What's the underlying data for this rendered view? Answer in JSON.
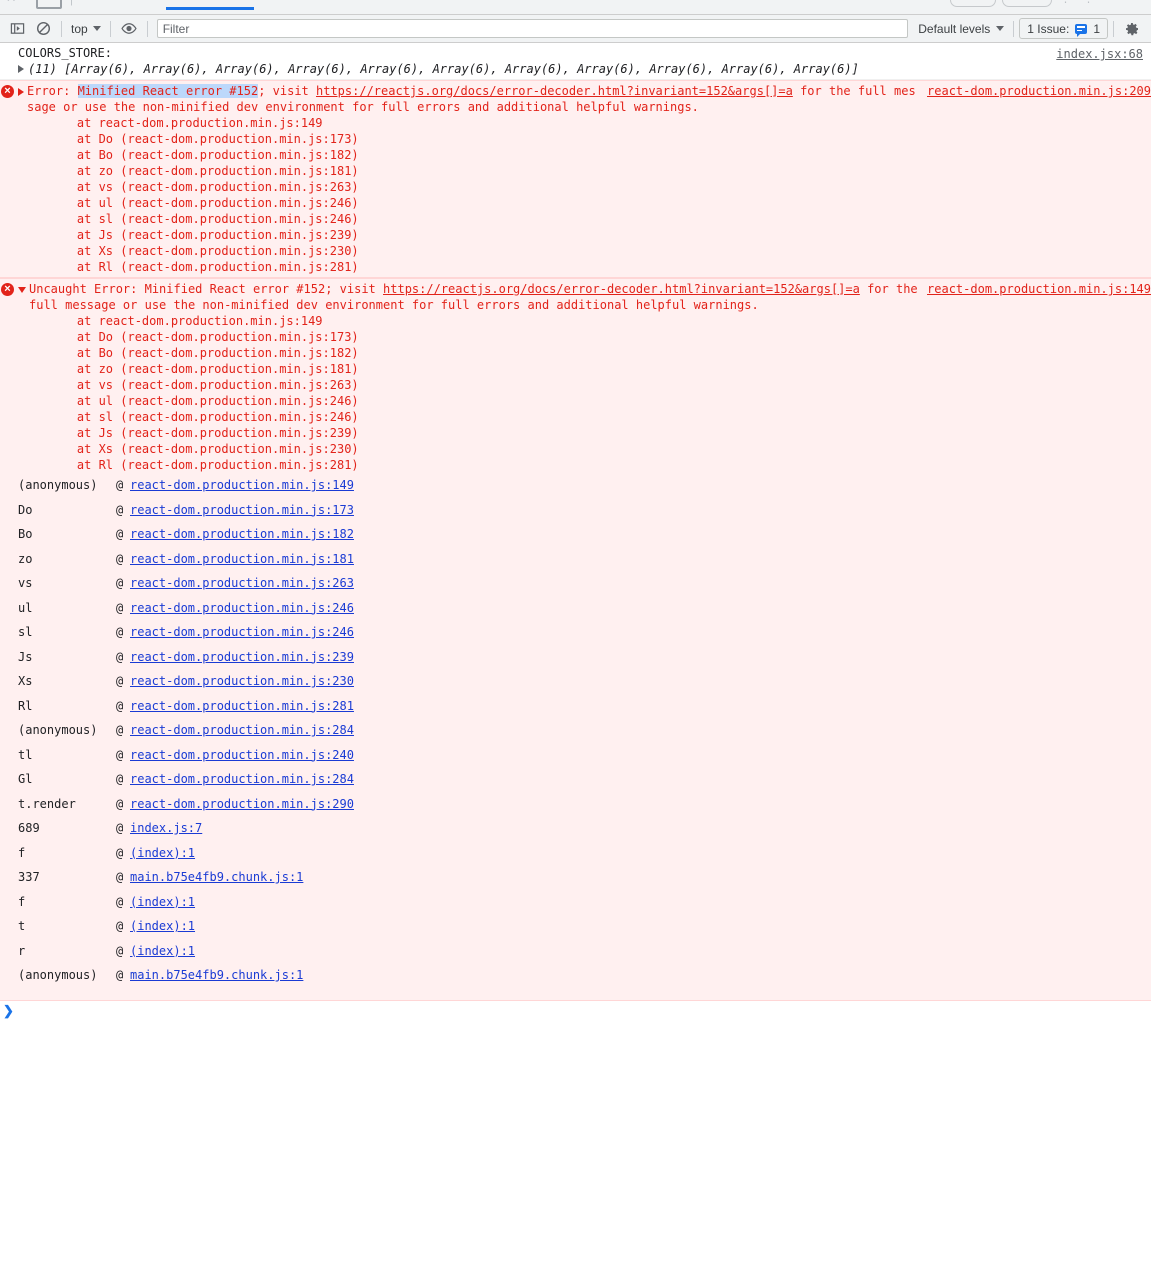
{
  "toolbar": {
    "sidebar_toggle_icon": "sidebar-toggle-icon",
    "clear_console_icon": "clear-console-icon",
    "context_label": "top",
    "eye_icon": "eye-icon",
    "filter_placeholder": "Filter",
    "filter_value": "",
    "levels_label": "Default levels",
    "issues_label": "1 Issue:",
    "issues_count": "1",
    "settings_icon": "gear-icon",
    "accent_color": "#1a73e8"
  },
  "console": {
    "log_message": {
      "label": "COLORS_STORE:",
      "preview": "(11) [Array(6), Array(6), Array(6), Array(6), Array(6), Array(6), Array(6), Array(6), Array(6), Array(6), Array(6)]",
      "source": "index.jsx:68"
    },
    "error_collapsed": {
      "prefix": "Error: ",
      "highlight": "Minified React error #152",
      "after_highlight": "; visit ",
      "link": "https://reactjs.org/docs/error-decoder.html?invariant=152&a",
      "link_tail": "rgs[]=a",
      "tail_text": " for the full message or use the non-minified dev environment for full errors and additional helpful warnings.",
      "source": "react-dom.production.min.js:209",
      "stack": [
        "    at react-dom.production.min.js:149",
        "    at Do (react-dom.production.min.js:173)",
        "    at Bo (react-dom.production.min.js:182)",
        "    at zo (react-dom.production.min.js:181)",
        "    at vs (react-dom.production.min.js:263)",
        "    at ul (react-dom.production.min.js:246)",
        "    at sl (react-dom.production.min.js:246)",
        "    at Js (react-dom.production.min.js:239)",
        "    at Xs (react-dom.production.min.js:230)",
        "    at Rl (react-dom.production.min.js:281)"
      ]
    },
    "error_expanded": {
      "prefix": "Uncaught Error: Minified React error #152; visit ",
      "link": "https://reactjs.org/docs/error-decoder.html?invari",
      "link_tail": "ant=152&args[]=a",
      "tail_text": " for the full message or use the non-minified dev environment for full errors and additional helpful warnings.",
      "source": "react-dom.production.min.js:149",
      "stack": [
        "    at react-dom.production.min.js:149",
        "    at Do (react-dom.production.min.js:173)",
        "    at Bo (react-dom.production.min.js:182)",
        "    at zo (react-dom.production.min.js:181)",
        "    at vs (react-dom.production.min.js:263)",
        "    at ul (react-dom.production.min.js:246)",
        "    at sl (react-dom.production.min.js:246)",
        "    at Js (react-dom.production.min.js:239)",
        "    at Xs (react-dom.production.min.js:230)",
        "    at Rl (react-dom.production.min.js:281)"
      ],
      "frames": [
        {
          "fn": "(anonymous)",
          "at": "@",
          "link": "react-dom.production.min.js:149"
        },
        {
          "fn": "Do",
          "at": "@",
          "link": "react-dom.production.min.js:173"
        },
        {
          "fn": "Bo",
          "at": "@",
          "link": "react-dom.production.min.js:182"
        },
        {
          "fn": "zo",
          "at": "@",
          "link": "react-dom.production.min.js:181"
        },
        {
          "fn": "vs",
          "at": "@",
          "link": "react-dom.production.min.js:263"
        },
        {
          "fn": "ul",
          "at": "@",
          "link": "react-dom.production.min.js:246"
        },
        {
          "fn": "sl",
          "at": "@",
          "link": "react-dom.production.min.js:246"
        },
        {
          "fn": "Js",
          "at": "@",
          "link": "react-dom.production.min.js:239"
        },
        {
          "fn": "Xs",
          "at": "@",
          "link": "react-dom.production.min.js:230"
        },
        {
          "fn": "Rl",
          "at": "@",
          "link": "react-dom.production.min.js:281"
        },
        {
          "fn": "(anonymous)",
          "at": "@",
          "link": "react-dom.production.min.js:284"
        },
        {
          "fn": "tl",
          "at": "@",
          "link": "react-dom.production.min.js:240"
        },
        {
          "fn": "Gl",
          "at": "@",
          "link": "react-dom.production.min.js:284"
        },
        {
          "fn": "t.render",
          "at": "@",
          "link": "react-dom.production.min.js:290"
        },
        {
          "fn": "689",
          "at": "@",
          "link": "index.js:7"
        },
        {
          "fn": "f",
          "at": "@",
          "link": "(index):1"
        },
        {
          "fn": "337",
          "at": "@",
          "link": "main.b75e4fb9.chunk.js:1"
        },
        {
          "fn": "f",
          "at": "@",
          "link": "(index):1"
        },
        {
          "fn": "t",
          "at": "@",
          "link": "(index):1"
        },
        {
          "fn": "r",
          "at": "@",
          "link": "(index):1"
        },
        {
          "fn": "(anonymous)",
          "at": "@",
          "link": "main.b75e4fb9.chunk.js:1"
        }
      ]
    },
    "prompt_chevron": "❯"
  }
}
